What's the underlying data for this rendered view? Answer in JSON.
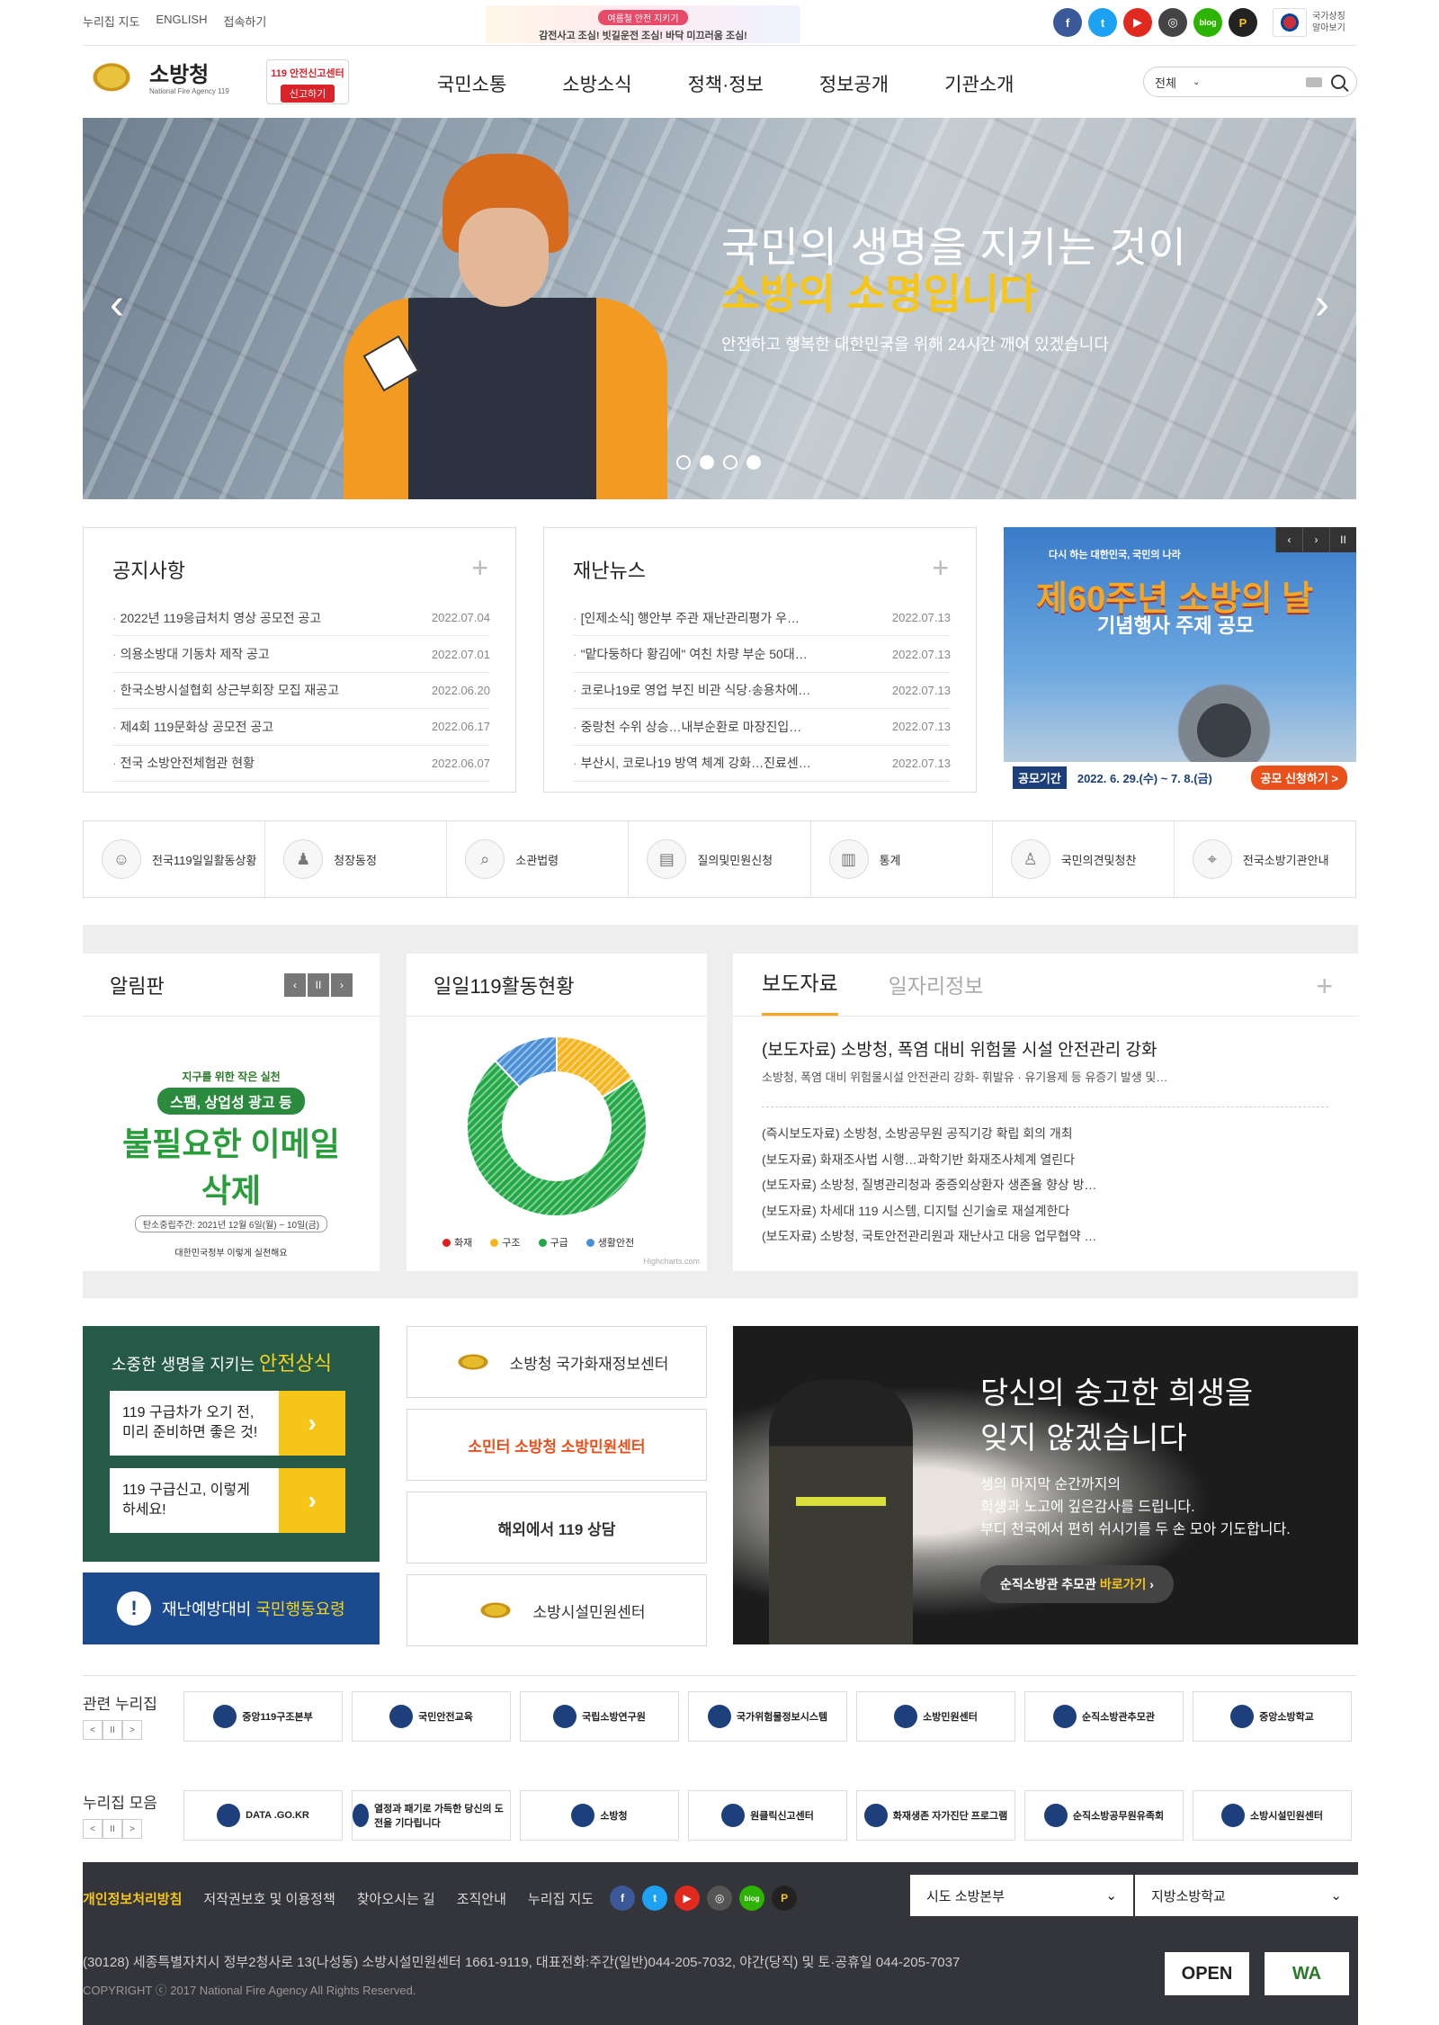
{
  "util": {
    "sitemap": "누리집 지도",
    "english": "ENGLISH",
    "access": "접속하기"
  },
  "mini_banner": {
    "tag": "여름철 안전 지키기",
    "text": "감전사고 조심! 빗길운전 조심! 바닥 미끄러움 조심!"
  },
  "social": [
    "f",
    "t",
    "▶",
    "◎",
    "blog",
    "P"
  ],
  "national": {
    "label": "국가상징 알아보기"
  },
  "logo": {
    "name": "소방청",
    "sub": "National Fire Agency 119"
  },
  "report": {
    "top": "119 안전신고센터",
    "btn": "신고하기"
  },
  "gnb": [
    "국민소통",
    "소방소식",
    "정책·정보",
    "정보공개",
    "기관소개"
  ],
  "search": {
    "scope": "전체"
  },
  "hero": {
    "line1": "국민의 생명을 지키는 것이",
    "line2": "소방의 소명입니다",
    "line3": "안전하고 행복한 대한민국을 위해 24시간 깨어 있겠습니다"
  },
  "notices": {
    "title": "공지사항",
    "items": [
      {
        "t": "2022년 119응급처치 영상 공모전 공고",
        "d": "2022.07.04"
      },
      {
        "t": "의용소방대 기동차 제작 공고",
        "d": "2022.07.01"
      },
      {
        "t": "한국소방시설협회 상근부회장 모집 재공고",
        "d": "2022.06.20"
      },
      {
        "t": "제4회 119문화상 공모전 공고",
        "d": "2022.06.17"
      },
      {
        "t": "전국 소방안전체험관 현황",
        "d": "2022.06.07"
      }
    ]
  },
  "news": {
    "title": "재난뉴스",
    "items": [
      {
        "t": "[인제소식] 행안부 주관 재난관리평가 우…",
        "d": "2022.07.13"
      },
      {
        "t": "\"맡다둥하다 황김에\" 여친 차량 부순 50대…",
        "d": "2022.07.13"
      },
      {
        "t": "코로나19로 영업 부진 비관 식당·송용차에…",
        "d": "2022.07.13"
      },
      {
        "t": "중랑천 수위 상승…내부순환로 마장진입…",
        "d": "2022.07.13"
      },
      {
        "t": "부산시, 코로나19 방역 체계 강화…진료센…",
        "d": "2022.07.13"
      }
    ]
  },
  "poster": {
    "top": "다시 하는 대한민국, 국민의 나라",
    "big": "제60주년 소방의 날",
    "sub": "기념행사 주제 공모",
    "label": "공모기간",
    "date": "2022. 6. 29.(수) ~ 7. 8.(금)",
    "btn": "공모 신청하기 >"
  },
  "quick": [
    {
      "label": "전국119일일활동상황",
      "icon": "people-icon"
    },
    {
      "label": "청장동정",
      "icon": "podium-icon"
    },
    {
      "label": "소관법령",
      "icon": "search-icon"
    },
    {
      "label": "질의및민원신청",
      "icon": "inbox-icon"
    },
    {
      "label": "통계",
      "icon": "chart-icon"
    },
    {
      "label": "국민의견및청찬",
      "icon": "person-icon"
    },
    {
      "label": "전국소방기관안내",
      "icon": "pin-icon"
    }
  ],
  "board": {
    "title": "알림판",
    "a": "지구를 위한 작은 실천",
    "b": "스팸, 상업성 광고 등",
    "c": "불필요한 이메일 삭제",
    "d": "탄소중립주간: 2021년 12월 6일(월) ~ 10일(금)",
    "e": "대한민국정부  이렇게 실천해요"
  },
  "activity": {
    "title": "일일119활동현황",
    "credit": "Highcharts.com"
  },
  "chart_data": {
    "type": "pie",
    "series": [
      {
        "name": "화재",
        "value": 0
      },
      {
        "name": "구조",
        "value": 16
      },
      {
        "name": "구급",
        "value": 72
      },
      {
        "name": "생활안전",
        "value": 12
      }
    ],
    "colors": [
      "#e02020",
      "#f5b51f",
      "#22a846",
      "#4a90d9"
    ]
  },
  "press": {
    "tab1": "보도자료",
    "tab2": "일자리정보",
    "lead_title": "(보도자료) 소방청, 폭염 대비 위험물 시설 안전관리 강화",
    "lead_sub": "소방청, 폭염 대비 위험물시설 안전관리 강화- 휘발유 · 유기용제 등 유증기 발생 및…",
    "items": [
      "(즉시보도자료) 소방청, 소방공무원 공직기강 확립 회의 개최",
      "(보도자료) 화재조사법 시행…과학기반 화재조사체계 열린다",
      "(보도자료) 소방청, 질병관리청과 중증외상환자 생존율 향상 방…",
      "(보도자료) 차세대 119 시스템, 디지털 신기술로 재설계한다",
      "(보도자료) 소방청, 국토안전관리원과 재난사고 대응 업무협약 …"
    ]
  },
  "safety": {
    "pre": "소중한 생명을 지키는 ",
    "hl": "안전상식",
    "box1": "119 구급차가 오기 전, 미리 준비하면 좋은 것!",
    "box2": "119 구급신고, 이렇게 하세요!",
    "go": "›"
  },
  "guide": {
    "pre": "재난예방대비 ",
    "hl": "국민행동요령"
  },
  "links": [
    "소방청 국가화재정보센터",
    "소민터  소방청 소방민원센터",
    "해외에서 119 상담",
    "소방시설민원센터"
  ],
  "memorial": {
    "l1": "당신의 숭고한 희생을",
    "l2": "잊지 않겠습니다",
    "b1": "생의 마지막 순간까지의",
    "b2": "희생과 노고에 깊은감사를 드립니다.",
    "b3": "부디 천국에서 편히 쉬시기를 두 손 모아 기도합니다.",
    "btn1": "순직소방관 추모관 ",
    "btn2": "바로가기",
    "btn3": " ›"
  },
  "related": {
    "label": "관련 누리집",
    "items": [
      "중앙119구조본부",
      "국민안전교육",
      "국립소방연구원",
      "국가위험물정보시스템",
      "소방민원센터",
      "순직소방관추모관",
      "중앙소방학교"
    ]
  },
  "collection": {
    "label": "누리집 모음",
    "items": [
      "DATA .GO.KR",
      "열정과 패기로 가득한 당신의 도전을 기다립니다",
      "소방청",
      "원클릭신고센터",
      "화재생존 자가진단 프로그램",
      "순직소방공무원유족회",
      "소방시설민원센터"
    ]
  },
  "pager": [
    "<",
    "II",
    ">"
  ],
  "footer": {
    "privacy": "개인정보처리방침",
    "copyright_policy": "저작권보호 및 이용정책",
    "directions": "찾아오시는 길",
    "org": "조직안내",
    "sitemap": "누리집 지도",
    "sel1": "시도 소방본부",
    "sel2": "지방소방학교",
    "addr": "(30128) 세종특별자치시 정부2청사로 13(나성동) 소방시설민원센터 1661-9119, 대표전화:주간(일반)044-205-7032, 야간(당직) 및 토·공휴일 044-205-7037",
    "copy": "COPYRIGHT ⓒ 2017 National Fire Agency All Rights Reserved.",
    "badge1": "OPEN",
    "badge2": "WA"
  }
}
